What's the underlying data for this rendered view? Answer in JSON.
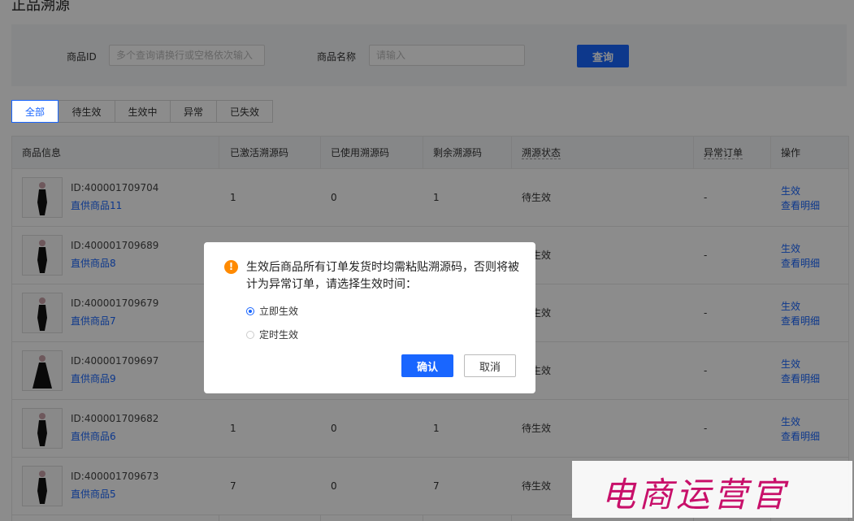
{
  "page": {
    "title": "正品溯源"
  },
  "search": {
    "product_id_label": "商品ID",
    "product_id_placeholder": "多个查询请换行或空格依次输入",
    "product_name_label": "商品名称",
    "product_name_placeholder": "请输入",
    "query_button": "查询"
  },
  "tabs": [
    {
      "label": "全部",
      "active": true
    },
    {
      "label": "待生效",
      "active": false
    },
    {
      "label": "生效中",
      "active": false
    },
    {
      "label": "异常",
      "active": false
    },
    {
      "label": "已失效",
      "active": false
    }
  ],
  "table": {
    "columns": [
      "商品信息",
      "已激活溯源码",
      "已使用溯源码",
      "剩余溯源码",
      "溯源状态",
      "异常订单",
      "操作"
    ],
    "rows": [
      {
        "id": "ID:400001709704",
        "name": "直供商品11",
        "activated": "1",
        "used": "0",
        "remaining": "1",
        "status": "待生效",
        "abnormal": "-",
        "op1": "生效",
        "op2": "查看明细"
      },
      {
        "id": "ID:400001709689",
        "name": "直供商品8",
        "activated": "",
        "used": "",
        "remaining": "",
        "status": "待生效",
        "abnormal": "-",
        "op1": "生效",
        "op2": "查看明细"
      },
      {
        "id": "ID:400001709679",
        "name": "直供商品7",
        "activated": "",
        "used": "",
        "remaining": "",
        "status": "待生效",
        "abnormal": "-",
        "op1": "生效",
        "op2": "查看明细"
      },
      {
        "id": "ID:400001709697",
        "name": "直供商品9",
        "activated": "",
        "used": "",
        "remaining": "",
        "status": "待生效",
        "abnormal": "-",
        "op1": "生效",
        "op2": "查看明细"
      },
      {
        "id": "ID:400001709682",
        "name": "直供商品6",
        "activated": "1",
        "used": "0",
        "remaining": "1",
        "status": "待生效",
        "abnormal": "-",
        "op1": "生效",
        "op2": "查看明细"
      },
      {
        "id": "ID:400001709673",
        "name": "直供商品5",
        "activated": "7",
        "used": "0",
        "remaining": "7",
        "status": "待生效",
        "abnormal": "",
        "op1": "",
        "op2": ""
      }
    ]
  },
  "modal": {
    "message": "生效后商品所有订单发货时均需粘贴溯源码，否则将被计为异常订单，请选择生效时间：",
    "option_immediate": "立即生效",
    "option_scheduled": "定时生效",
    "confirm": "确认",
    "cancel": "取消",
    "warning_icon": "warning-icon"
  },
  "watermark": {
    "text": "电商运营官"
  },
  "colors": {
    "accent": "#1966ff",
    "warning": "#ff8a00",
    "watermark": "#c8106a"
  }
}
